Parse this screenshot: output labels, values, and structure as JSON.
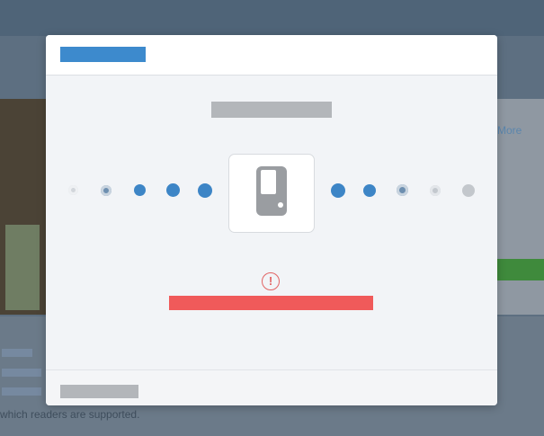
{
  "background": {
    "side_link_text": "More",
    "footer_text": "which readers are supported.",
    "colors": {
      "overlay": "#5d6f81",
      "accent_green": "#3f8a3c"
    }
  },
  "modal": {
    "header": {
      "title": "",
      "accent_color": "#3d8acd"
    },
    "step_title": "",
    "device": {
      "icon_name": "card-reader-icon"
    },
    "progress_dots": {
      "colors": {
        "active": "#3d85c6",
        "faded": "#aeb4bb",
        "ring": "#c9cdd2"
      }
    },
    "warning": {
      "icon_name": "warning-icon",
      "glyph": "!",
      "color": "#e26464"
    },
    "error_message": "",
    "error_color": "#f05a5a",
    "footer": {
      "button_label": ""
    }
  }
}
